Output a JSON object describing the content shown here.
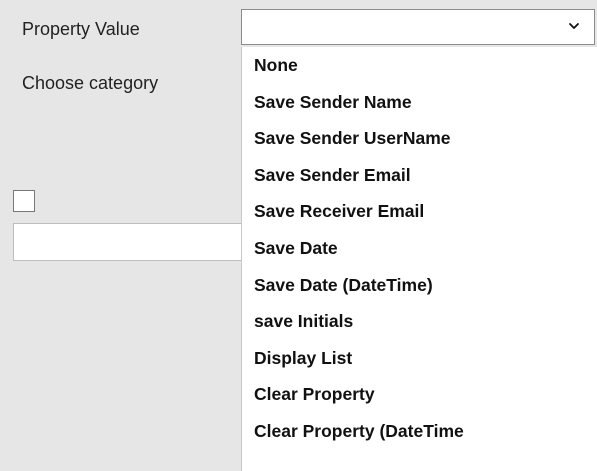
{
  "form": {
    "property_label": "Property Value",
    "category_label": "Choose category",
    "select_value": "",
    "checkbox_checked": false,
    "text_value": ""
  },
  "dropdown": {
    "items": [
      "None",
      "Save Sender Name",
      "Save Sender UserName",
      "Save Sender Email",
      "Save Receiver Email",
      "Save Date",
      "Save Date (DateTime)",
      "save Initials",
      "Display List",
      "Clear Property",
      "Clear Property (DateTime"
    ]
  },
  "icons": {
    "select_chevron": "chevron-down-icon"
  }
}
